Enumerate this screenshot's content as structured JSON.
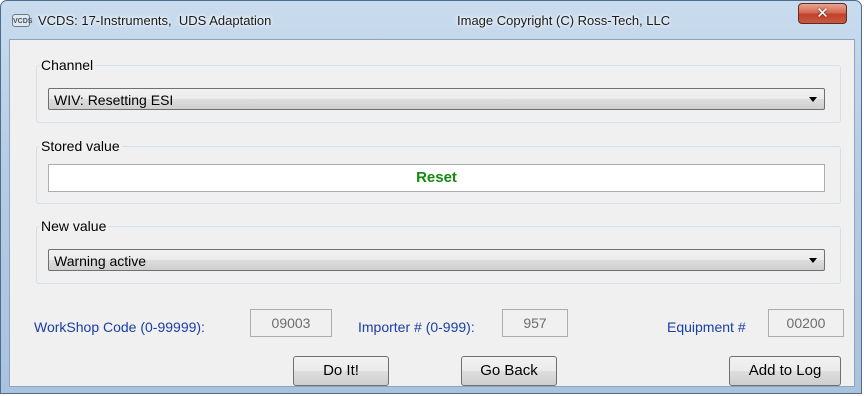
{
  "window": {
    "title": "VCDS: 17-Instruments,  UDS Adaptation",
    "copyright": "Image Copyright (C) Ross-Tech, LLC",
    "icon": "vcds-app-icon",
    "close_glyph": "✕"
  },
  "channel": {
    "label": "Channel",
    "value": "WIV: Resetting ESI"
  },
  "stored": {
    "label": "Stored value",
    "value": "Reset",
    "value_color": "#118a11"
  },
  "new_value": {
    "label": "New value",
    "value": "Warning active"
  },
  "codes": {
    "workshop_label": "WorkShop Code (0-99999):",
    "workshop_value": "09003",
    "importer_label": "Importer # (0-999):",
    "importer_value": "957",
    "equipment_label": "Equipment #",
    "equipment_value": "00200"
  },
  "buttons": {
    "do_it": "Do It!",
    "go_back": "Go Back",
    "add_to_log": "Add to Log"
  }
}
